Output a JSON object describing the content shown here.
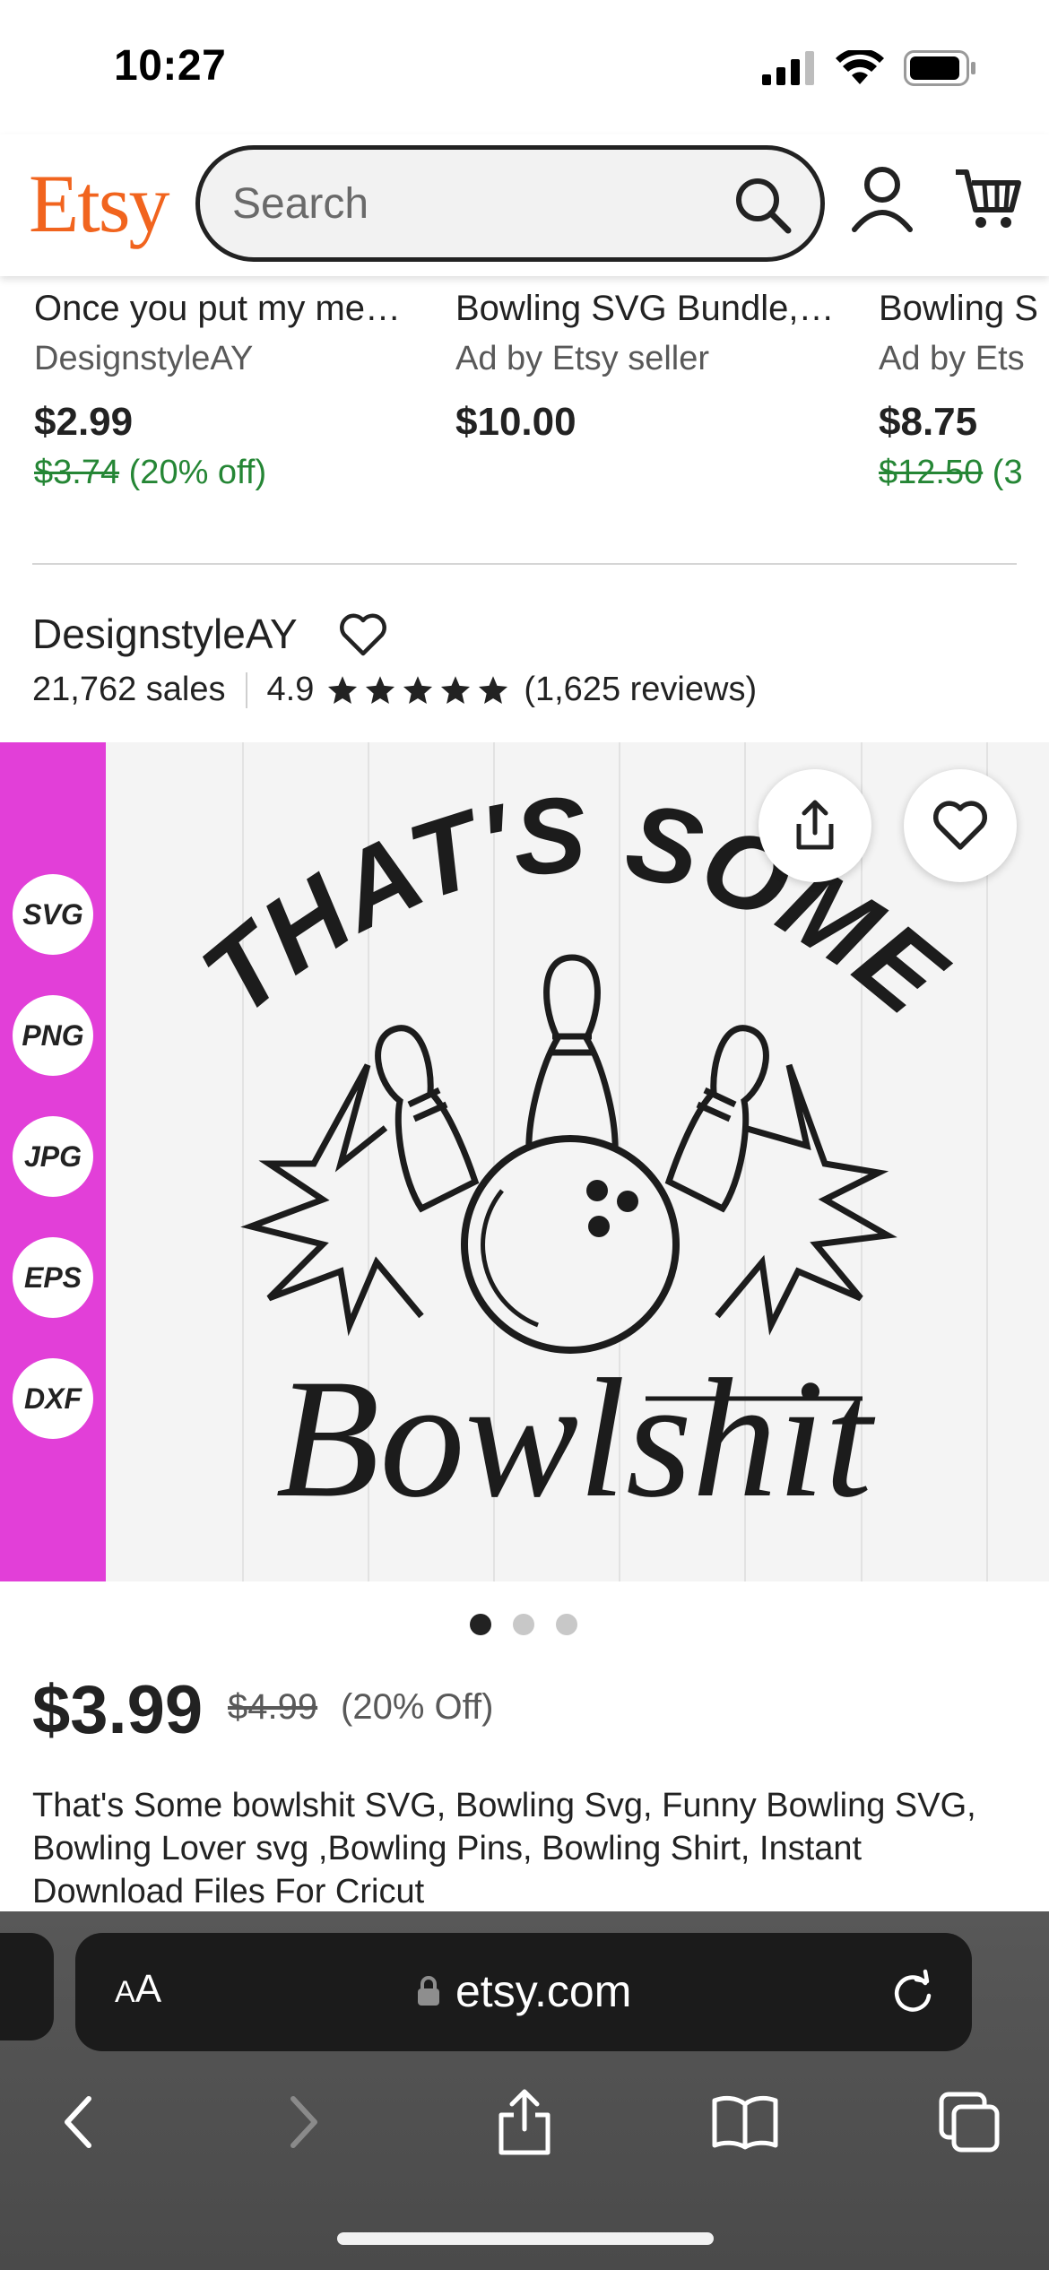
{
  "status_bar": {
    "time": "10:27"
  },
  "header": {
    "logo": "Etsy",
    "search": {
      "placeholder": "Search",
      "value": ""
    }
  },
  "related_listings": [
    {
      "title": "Once you put my me…",
      "seller": "DesignstyleAY",
      "price": "$2.99",
      "original_price": "$3.74",
      "discount": "(20% off)"
    },
    {
      "title": "Bowling SVG Bundle, …",
      "seller": "Ad by Etsy seller",
      "price": "$10.00",
      "original_price": "",
      "discount": ""
    },
    {
      "title": "Bowling S",
      "seller": "Ad by Ets",
      "price": "$8.75",
      "original_price": "$12.50",
      "discount": "(3"
    }
  ],
  "shop": {
    "name": "DesignstyleAY",
    "sales": "21,762 sales",
    "rating": "4.9",
    "stars": 5,
    "reviews": "(1,625 reviews)"
  },
  "listing_image": {
    "headline": "THAT'S SOME",
    "script_word": "Bowlshit",
    "formats": [
      "SVG",
      "PNG",
      "JPG",
      "EPS",
      "DXF"
    ],
    "strip_color": "#E23FD8",
    "current_image": 1,
    "image_count": 3
  },
  "listing": {
    "price": "$3.99",
    "original_price": "$4.99",
    "discount": "(20% Off)",
    "description": "That's Some bowlshit SVG, Bowling Svg, Funny Bowling SVG, Bowling Lover svg ,Bowling Pins, Bowling Shirt, Instant Download Files For Cricut"
  },
  "browser": {
    "aa_small": "A",
    "aa_large": "A",
    "url": "etsy.com"
  },
  "colors": {
    "brand": "#F1641E",
    "sale_green": "#258635",
    "text": "#222222"
  }
}
